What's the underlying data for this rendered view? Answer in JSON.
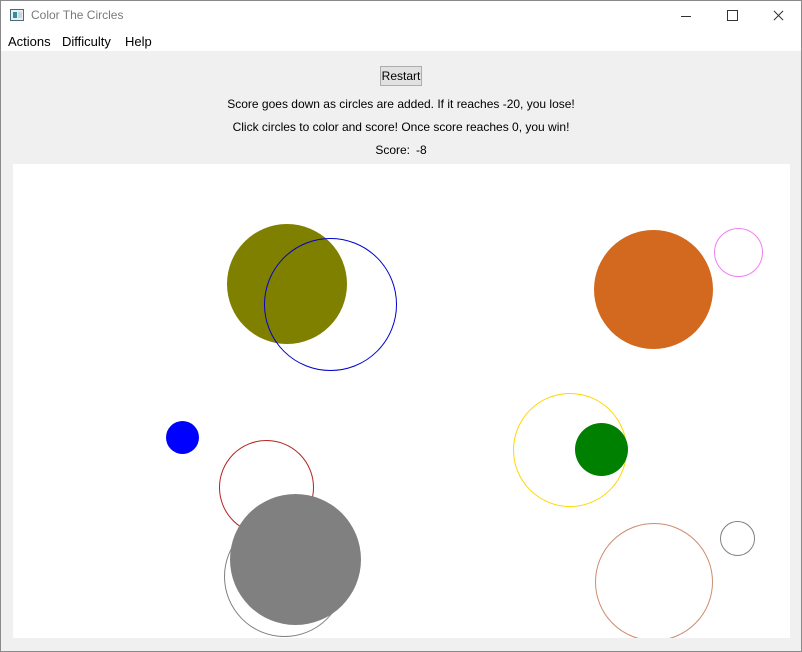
{
  "window": {
    "title": "Color The Circles",
    "icon": "app-window-icon",
    "controls": [
      "minimize-icon",
      "maximize-icon",
      "close-icon"
    ]
  },
  "menu": {
    "actions": "Actions",
    "difficulty": "Difficulty",
    "help": "Help"
  },
  "controls": {
    "restart_label": "Restart",
    "info_line1": "Score goes down as circles are added. If it reaches -20, you lose!",
    "info_line2": "Click circles to color and score! Once score reaches 0, you win!",
    "score_label": "Score:",
    "score_value": "-8"
  },
  "circles": [
    {
      "id": "olive-filled",
      "filled": true,
      "color": "#808000"
    },
    {
      "id": "blue-outline",
      "filled": false,
      "color": "#0000cc"
    },
    {
      "id": "orange-filled",
      "filled": true,
      "color": "#d2691e"
    },
    {
      "id": "violet-outline",
      "filled": false,
      "color": "#ee82ee"
    },
    {
      "id": "blue-small-filled",
      "filled": true,
      "color": "#0000ff"
    },
    {
      "id": "brown-outline",
      "filled": false,
      "color": "#b22222"
    },
    {
      "id": "gold-outline",
      "filled": false,
      "color": "#ffd700"
    },
    {
      "id": "green-filled",
      "filled": true,
      "color": "#008000"
    },
    {
      "id": "gray-outline-large",
      "filled": false,
      "color": "#808080"
    },
    {
      "id": "gray-filled",
      "filled": true,
      "color": "#808080"
    },
    {
      "id": "gray-outline-small",
      "filled": false,
      "color": "#808080"
    },
    {
      "id": "peach-outline",
      "filled": false,
      "color": "#cd8c6f"
    }
  ]
}
